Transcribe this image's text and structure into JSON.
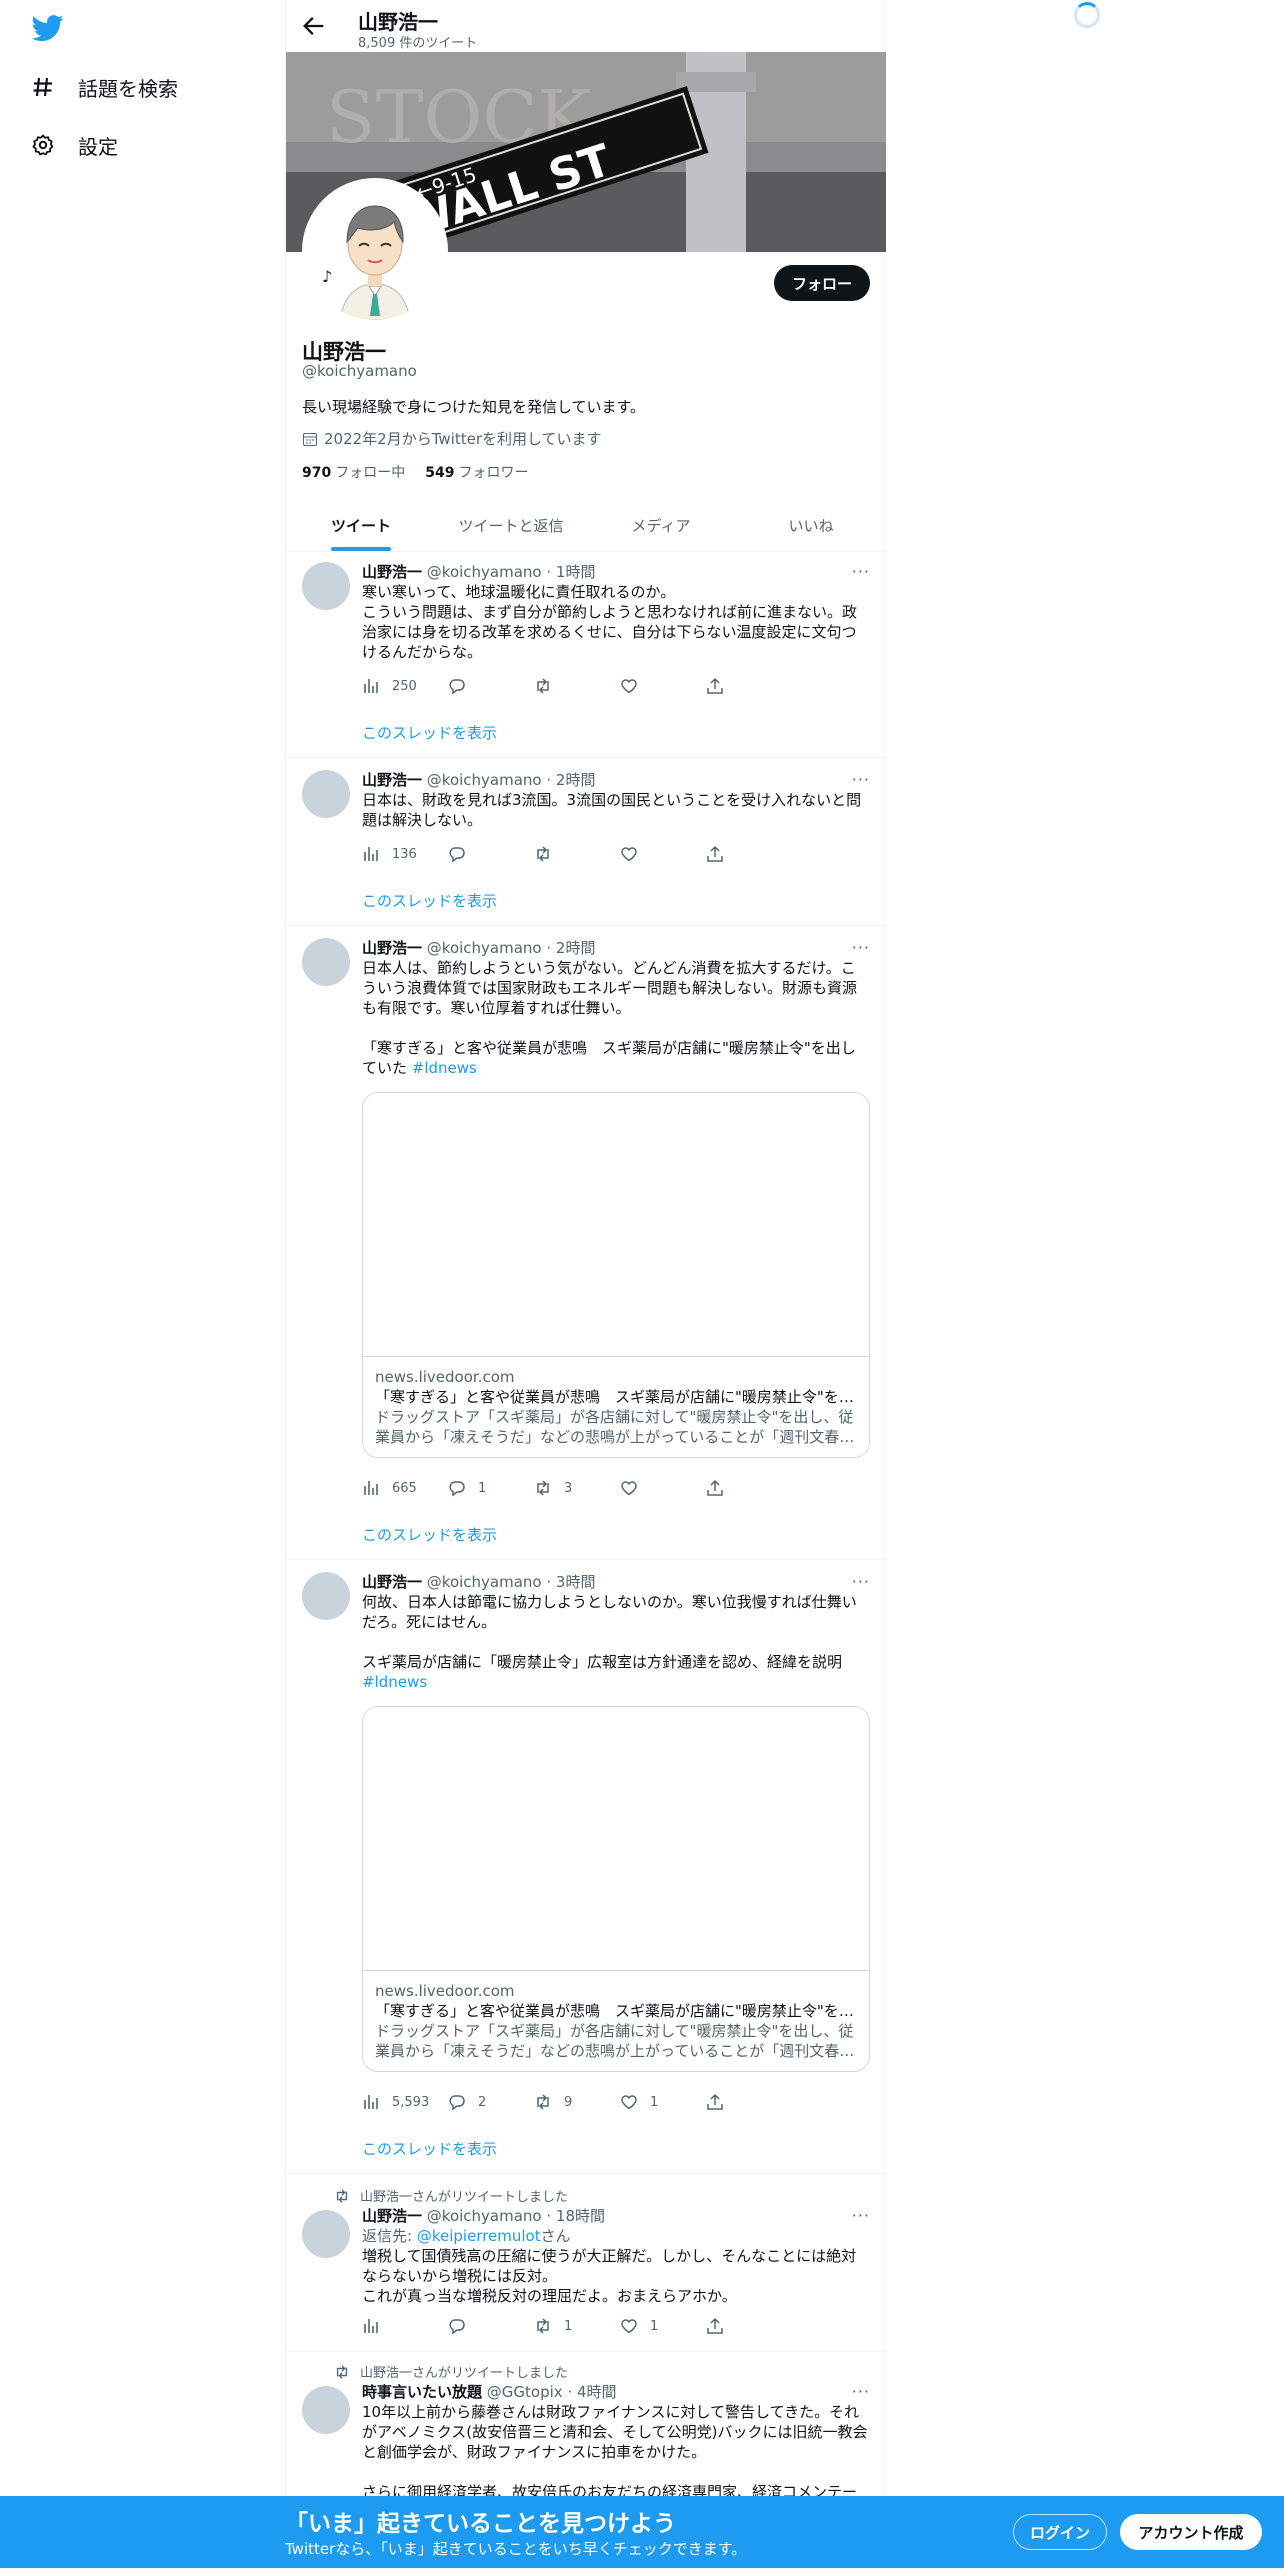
{
  "sidebar": {
    "items": [
      {
        "label": "話題を検索",
        "icon": "hashtag-icon"
      },
      {
        "label": "設定",
        "icon": "gear-icon"
      }
    ]
  },
  "header": {
    "name": "山野浩一",
    "tweet_count": "8,509 件のツイート"
  },
  "profile": {
    "name": "山野浩一",
    "handle": "@koichyamano",
    "bio": "長い現場経験で身につけた知見を発信しています。",
    "joined": "2022年2月からTwitterを利用しています",
    "following_count": "970",
    "following_label": "フォロー中",
    "followers_count": "549",
    "followers_label": "フォロワー",
    "follow_button": "フォロー",
    "banner_sign_text": "WALL ST",
    "banner_sign_num": "←9-15",
    "banner_bg_text": "STOCK"
  },
  "tabs": [
    "ツイート",
    "ツイートと返信",
    "メディア",
    "いいね"
  ],
  "show_thread": "このスレッドを表示",
  "tweets": [
    {
      "name": "山野浩一",
      "handle": "@koichyamano",
      "time": "1時間",
      "text": "寒い寒いって、地球温暖化に責任取れるのか。\nこういう問題は、まず自分が節約しようと思わなければ前に進まない。政治家には身を切る改革を求めるくせに、自分は下らない温度設定に文句つけるんだからな。",
      "views": "250",
      "replies": "",
      "retweets": "",
      "likes": ""
    },
    {
      "name": "山野浩一",
      "handle": "@koichyamano",
      "time": "2時間",
      "text": "日本は、財政を見れば3流国。3流国の国民ということを受け入れないと問題は解決しない。",
      "views": "136",
      "replies": "",
      "retweets": "",
      "likes": ""
    },
    {
      "name": "山野浩一",
      "handle": "@koichyamano",
      "time": "2時間",
      "text": "日本人は、節約しようという気がない。どんどん消費を拡大するだけ。こういう浪費体質では国家財政もエネルギー問題も解決しない。財源も資源も有限です。寒い位厚着すれば仕舞い。\n\n「寒すぎる」と客や従業員が悲鳴　スギ薬局が店舗に\"暖房禁止令\"を出していた ",
      "hashtag": "#ldnews",
      "card_domain": "news.livedoor.com",
      "card_title": "「寒すぎる」と客や従業員が悲鳴　スギ薬局が店舗に\"暖房禁止令\"を出していた",
      "card_desc": "ドラッグストア「スギ薬局」が各店舗に対して\"暖房禁止令\"を出し、従業員から「凍えそうだ」などの悲鳴が上がっていることが「週刊文春」の取材で分かった。",
      "views": "665",
      "replies": "1",
      "retweets": "3",
      "likes": ""
    },
    {
      "name": "山野浩一",
      "handle": "@koichyamano",
      "time": "3時間",
      "text": "何故、日本人は節電に協力しようとしないのか。寒い位我慢すれば仕舞いだろ。死にはせん。\n\nスギ薬局が店舗に「暖房禁止令」広報室は方針通達を認め、経緯を説明\n",
      "hashtag": "#ldnews",
      "card_domain": "news.livedoor.com",
      "card_title": "「寒すぎる」と客や従業員が悲鳴　スギ薬局が店舗に\"暖房禁止令\"を出していた",
      "card_desc": "ドラッグストア「スギ薬局」が各店舗に対して\"暖房禁止令\"を出し、従業員から「凍えそうだ」などの悲鳴が上がっていることが「週刊文春」の取材で分かった。",
      "views": "5,593",
      "replies": "2",
      "retweets": "9",
      "likes": "1"
    },
    {
      "retweet_label": "山野浩一さんがリツイートしました",
      "name": "山野浩一",
      "handle": "@koichyamano",
      "time": "18時間",
      "reply_prefix": "返信先: ",
      "reply_to": "@keipierremulot",
      "reply_suffix": "さん",
      "text": "増税して国債残高の圧縮に使うが大正解だ。しかし、そんなことには絶対ならないから増税には反対。\nこれが真っ当な増税反対の理屈だよ。おまえらアホか。",
      "views": "",
      "replies": "",
      "retweets": "1",
      "likes": "1"
    },
    {
      "retweet_label": "山野浩一さんがリツイートしました",
      "name": "時事言いたい放題",
      "handle": "@GGtopix",
      "time": "4時間",
      "text": "10年以上前から藤巻さんは財政ファイナンスに対して警告してきた。それがアベノミクス(故安倍晋三と清和会、そして公明党)バックには旧統一教会と創価学会が、財政ファイナンスに拍車をかけた。\n\nさらに御用経済学者、故安倍氏のお友だちの経済専門家、経済コメンテー"
    }
  ],
  "bottom_bar": {
    "title": "「いま」起きていることを見つけよう",
    "subtitle": "Twitterなら、「いま」起きていることをいち早くチェックできます。",
    "login": "ログイン",
    "signup": "アカウント作成"
  },
  "colors": {
    "accent": "#1d9bf0",
    "text": "#0f1419",
    "muted": "#536471"
  }
}
